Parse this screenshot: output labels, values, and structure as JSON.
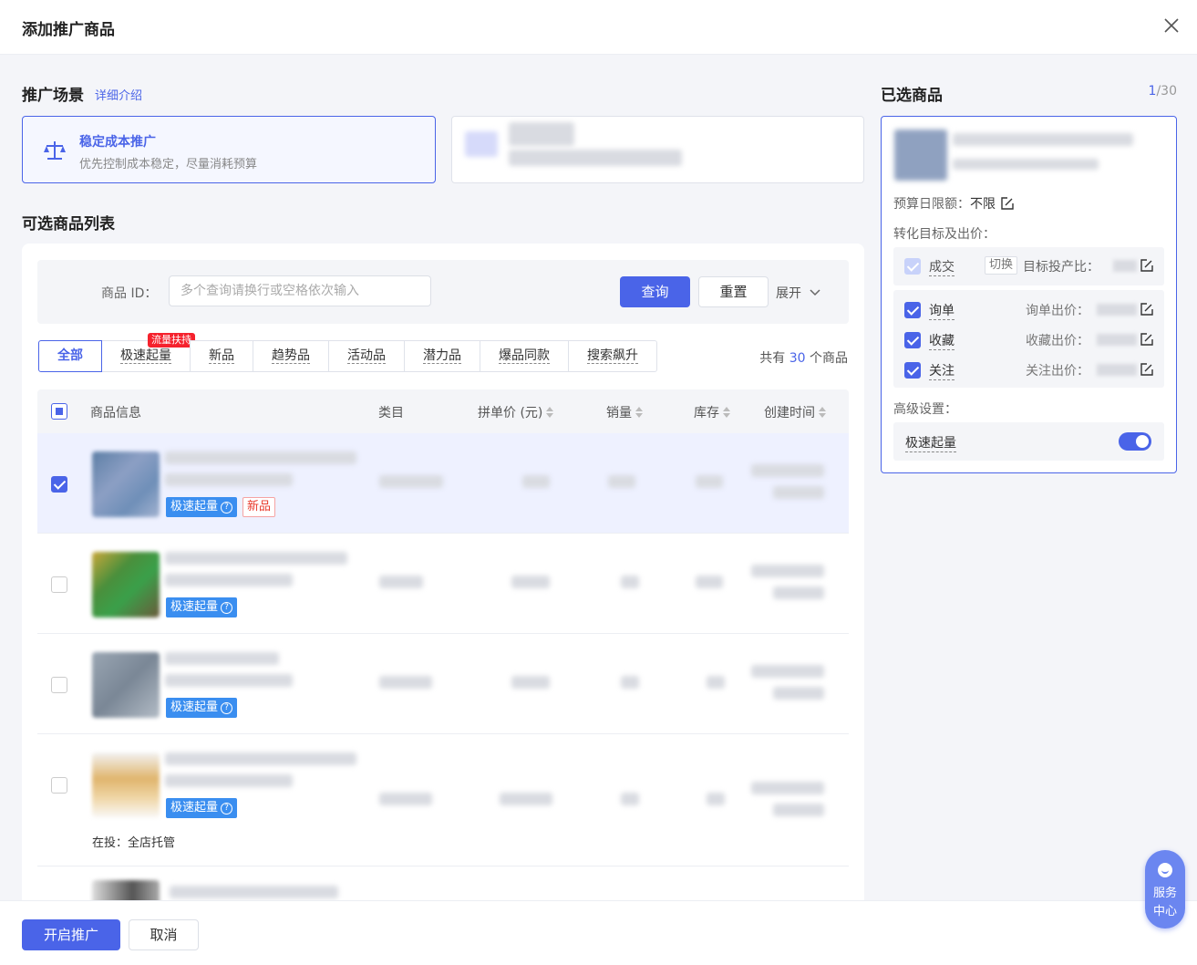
{
  "modal": {
    "title": "添加推广商品"
  },
  "scene": {
    "title": "推广场景",
    "link": "详细介绍",
    "active_card": {
      "title": "稳定成本推广",
      "desc": "优先控制成本稳定，尽量消耗预算"
    }
  },
  "list": {
    "title": "可选商品列表",
    "filter": {
      "label": "商品 ID：",
      "placeholder": "多个查询请换行或空格依次输入",
      "query": "查询",
      "reset": "重置",
      "expand": "展开"
    },
    "tabs": [
      {
        "label": "全部",
        "active": true
      },
      {
        "label": "极速起量",
        "badge": "流量扶持"
      },
      {
        "label": "新品"
      },
      {
        "label": "趋势品"
      },
      {
        "label": "活动品"
      },
      {
        "label": "潜力品"
      },
      {
        "label": "爆品同款"
      },
      {
        "label": "搜索飙升"
      }
    ],
    "total_prefix": "共有",
    "total_count": "30",
    "total_suffix": "个商品",
    "columns": [
      "商品信息",
      "类目",
      "拼单价 (元)",
      "销量",
      "库存",
      "创建时间"
    ],
    "rows": [
      {
        "checked": true,
        "tag": "极速起量",
        "new_tag": "新品"
      },
      {
        "checked": false,
        "tag": "极速起量"
      },
      {
        "checked": false,
        "tag": "极速起量"
      },
      {
        "checked": false,
        "tag": "极速起量",
        "status": "在投：全店托管"
      }
    ]
  },
  "selected": {
    "title": "已选商品",
    "count": "1",
    "max": "/30",
    "budget_label": "预算日限额：",
    "budget_value": "不限",
    "goal_label": "转化目标及出价：",
    "primary_goal": {
      "name": "成交",
      "switch": "切换",
      "roi_label": "目标投产比："
    },
    "goals": [
      {
        "name": "询单",
        "bid_label": "询单出价："
      },
      {
        "name": "收藏",
        "bid_label": "收藏出价："
      },
      {
        "name": "关注",
        "bid_label": "关注出价："
      }
    ],
    "advanced_label": "高级设置：",
    "advanced_item": "极速起量",
    "advanced_on": true
  },
  "footer": {
    "start": "开启推广",
    "cancel": "取消"
  },
  "service": {
    "line1": "服务",
    "line2": "中心"
  },
  "colors": {
    "accent": "#4a64e8",
    "tag_blue": "#3a8ef0",
    "badge_red": "#f5222d"
  }
}
